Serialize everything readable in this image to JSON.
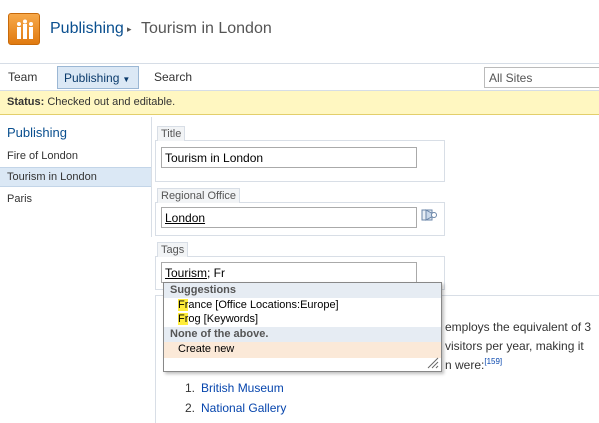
{
  "header": {
    "breadcrumb_site": "Publishing",
    "breadcrumb_sep": "▸",
    "breadcrumb_page": "Tourism in London"
  },
  "topnav": {
    "team": "Team",
    "publishing": "Publishing",
    "publishing_caret": "▼",
    "search": "Search",
    "scope": "All Sites"
  },
  "status": {
    "label": "Status:",
    "text": "Checked out and editable."
  },
  "leftnav": {
    "heading": "Publishing",
    "items": [
      {
        "label": "Fire of London"
      },
      {
        "label": "Tourism in London",
        "selected": true
      },
      {
        "label": "Paris"
      }
    ]
  },
  "form": {
    "title_label": "Title",
    "title_value": "Tourism in London",
    "office_label": "Regional Office",
    "office_value": "London",
    "tags_label": "Tags",
    "tags_value_term": "Tourism",
    "tags_value_rest": "; Fr"
  },
  "suggestions": {
    "heading": "Suggestions",
    "items": [
      {
        "match": "Fr",
        "rest": "ance [Office Locations:Europe]"
      },
      {
        "match": "Fr",
        "rest": "og [Keywords]"
      }
    ],
    "none_heading": "None of the above.",
    "create_label": "Create new"
  },
  "content": {
    "line1": "employs the equivalent of 3",
    "line2": "visitors per year, making it",
    "line3": "n were:",
    "ref": "[159]",
    "list": [
      {
        "num": "1.",
        "label": "British Museum"
      },
      {
        "num": "2.",
        "label": "National Gallery"
      }
    ]
  },
  "colors": {
    "accent": "#0a4f8f",
    "status_bg": "#fff7c1",
    "highlight": "#ffed3a",
    "selected_nav": "#dbe8f5",
    "logo": "#e88a1a"
  },
  "icons": [
    "sites-logo-icon",
    "address-book-icon",
    "resize-grip-icon"
  ]
}
